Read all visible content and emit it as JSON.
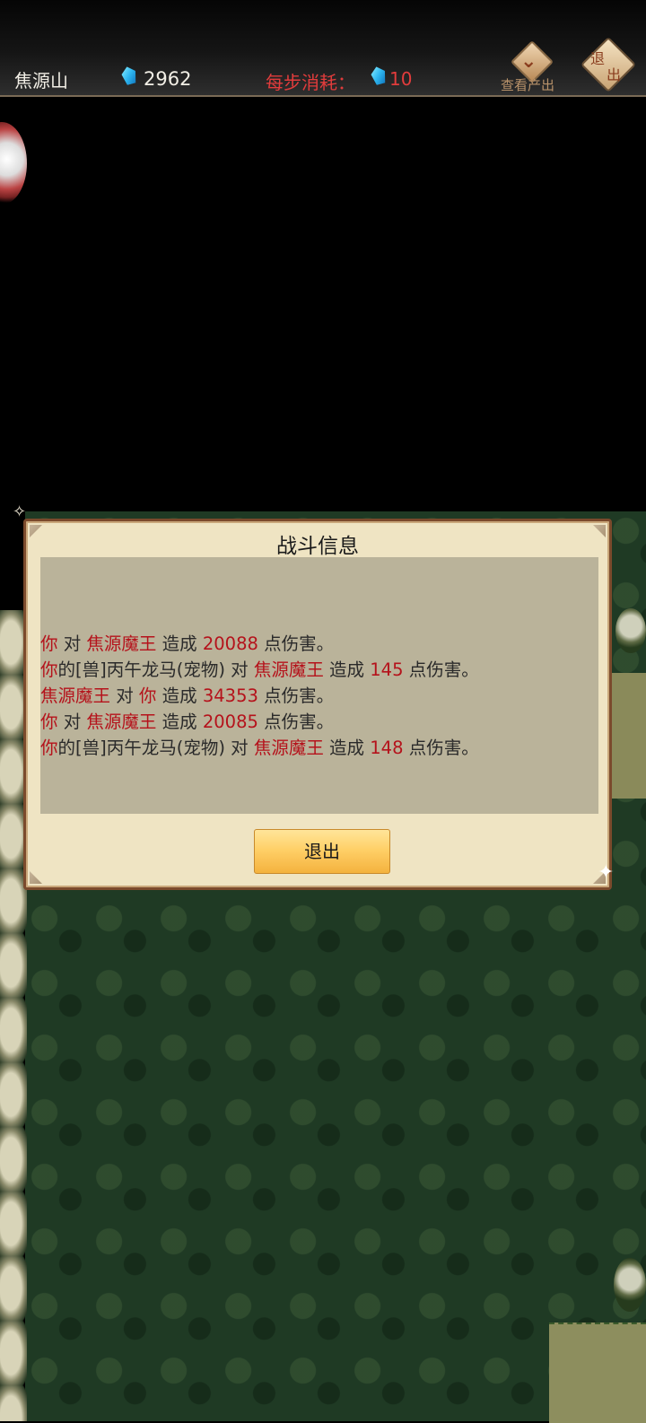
{
  "topbar": {
    "location": "焦源山",
    "gem_count": "2962",
    "cost_label": "每步消耗：",
    "cost_value": "10",
    "view_output_label": "查看产出",
    "exit_label_1": "退",
    "exit_label_2": "出"
  },
  "icons": {
    "gem": "blue-gem-icon",
    "view_output": "chevron-down-diamond-icon",
    "exit": "diamond-exit-icon"
  },
  "dialog": {
    "title": "战斗信息",
    "log": [
      {
        "a": "你",
        "b": " 对 ",
        "c": "焦源魔王",
        "d": " 造成 ",
        "e": "20088",
        "f": " 点伤害。"
      },
      {
        "a": "你",
        "b": "的[兽]丙午龙马(宠物) 对 ",
        "c": "焦源魔王",
        "d": " 造成 ",
        "e": "145",
        "f": " 点伤害。"
      },
      {
        "a": "焦源魔王",
        "b": " 对 ",
        "c": "你",
        "d": " 造成 ",
        "e": "34353",
        "f": " 点伤害。"
      },
      {
        "a": "你",
        "b": " 对 ",
        "c": "焦源魔王",
        "d": " 造成 ",
        "e": "20085",
        "f": " 点伤害。"
      },
      {
        "a": "你",
        "b": "的[兽]丙午龙马(宠物) 对 ",
        "c": "焦源魔王",
        "d": " 造成 ",
        "e": "148",
        "f": " 点伤害。"
      }
    ],
    "exit_button": "退出"
  },
  "colors": {
    "highlight_red": "#b5121b",
    "cost_red": "#e23c3c",
    "dialog_bg": "#efe4c3",
    "exit_button": "#ffd068"
  }
}
